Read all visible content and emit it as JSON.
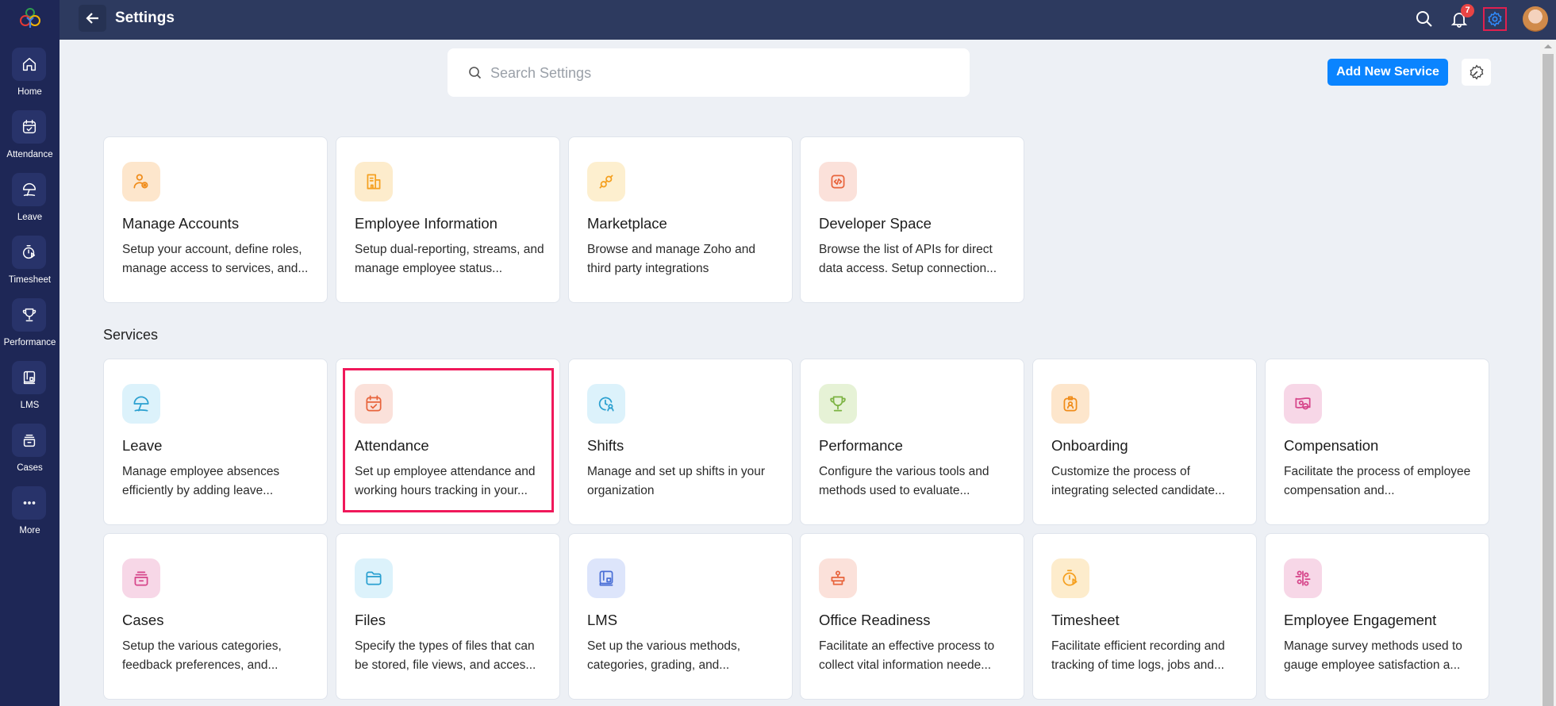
{
  "header": {
    "title": "Settings",
    "notification_count": "7",
    "icons": [
      "back-arrow-icon",
      "search-icon",
      "bell-icon",
      "gear-icon",
      "avatar"
    ]
  },
  "sidebar": {
    "items": [
      {
        "label": "Home",
        "icon": "home"
      },
      {
        "label": "Attendance",
        "icon": "calendar-check"
      },
      {
        "label": "Leave",
        "icon": "umbrella"
      },
      {
        "label": "Timesheet",
        "icon": "timer"
      },
      {
        "label": "Performance",
        "icon": "trophy"
      },
      {
        "label": "LMS",
        "icon": "book"
      },
      {
        "label": "Cases",
        "icon": "cases"
      },
      {
        "label": "More",
        "icon": "dots"
      }
    ]
  },
  "search": {
    "placeholder": "Search Settings",
    "value": ""
  },
  "toolbar": {
    "add_service_label": "Add New Service"
  },
  "services_heading": "Services",
  "colors": {
    "accent": "#0a84ff",
    "highlight": "#f0185a",
    "sidebar": "#1e2756",
    "topbar": "#2d3a5f"
  },
  "general_cards": [
    {
      "title": "Manage Accounts",
      "desc": "Setup your account, define roles, manage access to services, and...",
      "icon": "user-gear",
      "bg": "#fde6cc",
      "fg": "#f08c1a"
    },
    {
      "title": "Employee Information",
      "desc": "Setup dual-reporting, streams, and manage employee status...",
      "icon": "building",
      "bg": "#fdeccc",
      "fg": "#f5a020"
    },
    {
      "title": "Marketplace",
      "desc": "Browse and manage Zoho and third party integrations",
      "icon": "plug",
      "bg": "#fdefcf",
      "fg": "#f5a020"
    },
    {
      "title": "Developer Space",
      "desc": "Browse the list of APIs for direct data access. Setup connection...",
      "icon": "code",
      "bg": "#fbe1da",
      "fg": "#e8643c"
    }
  ],
  "service_cards": [
    {
      "title": "Leave",
      "desc": "Manage employee absences efficiently by adding leave...",
      "icon": "umbrella",
      "bg": "#dcf2fb",
      "fg": "#2aa0d0"
    },
    {
      "title": "Attendance",
      "desc": "Set up employee attendance and working hours tracking in your...",
      "icon": "calendar-check",
      "bg": "#fbe1da",
      "fg": "#e8643c",
      "highlighted": true
    },
    {
      "title": "Shifts",
      "desc": "Manage and set up shifts in your organization",
      "icon": "clock-user",
      "bg": "#dcf2fb",
      "fg": "#2aa0d0"
    },
    {
      "title": "Performance",
      "desc": "Configure the various tools and methods used to evaluate...",
      "icon": "trophy",
      "bg": "#e6f2d6",
      "fg": "#7cb342"
    },
    {
      "title": "Onboarding",
      "desc": "Customize the process of integrating selected candidate...",
      "icon": "badge",
      "bg": "#fde6cc",
      "fg": "#f08c1a"
    },
    {
      "title": "Compensation",
      "desc": "Facilitate the process of employee compensation and...",
      "icon": "money",
      "bg": "#f7d7e7",
      "fg": "#d6458a"
    },
    {
      "title": "Cases",
      "desc": "Setup the various categories, feedback preferences, and...",
      "icon": "cases",
      "bg": "#f7d7e7",
      "fg": "#d6458a"
    },
    {
      "title": "Files",
      "desc": "Specify the types of files that can be stored, file views, and acces...",
      "icon": "folder",
      "bg": "#dcf2fb",
      "fg": "#2aa0d0"
    },
    {
      "title": "LMS",
      "desc": "Set up the various methods, categories, grading, and...",
      "icon": "book",
      "bg": "#dde5fb",
      "fg": "#4a6fd6"
    },
    {
      "title": "Office Readiness",
      "desc": "Facilitate an effective process to collect vital information neede...",
      "icon": "desk",
      "bg": "#fbe1da",
      "fg": "#e8643c"
    },
    {
      "title": "Timesheet",
      "desc": "Facilitate efficient recording and tracking of time logs, jobs and...",
      "icon": "timer",
      "bg": "#fdeccc",
      "fg": "#f5a020"
    },
    {
      "title": "Employee Engagement",
      "desc": "Manage survey methods used to gauge employee satisfaction a...",
      "icon": "sliders",
      "bg": "#f7d7e7",
      "fg": "#d6458a"
    }
  ]
}
